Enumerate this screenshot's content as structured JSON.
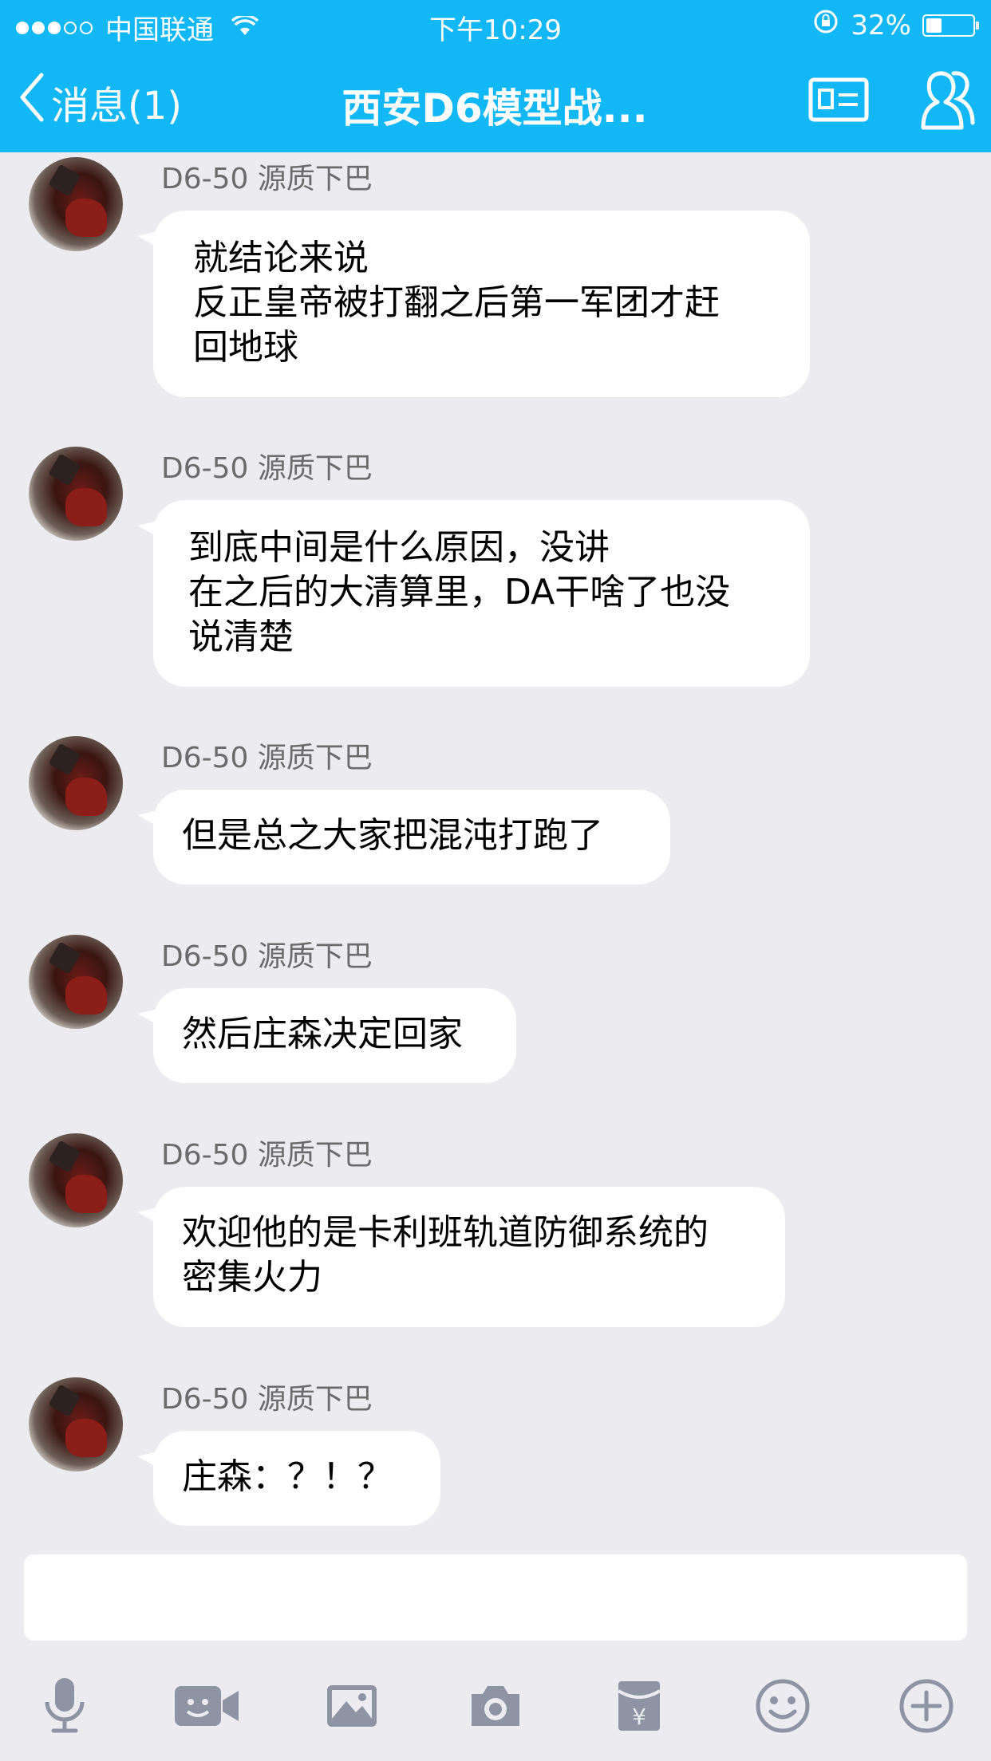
{
  "status_bar": {
    "carrier": "中国联通",
    "time": "下午10:29",
    "battery_percent": "32%",
    "battery_level": 0.32
  },
  "nav": {
    "back_label": "消息(1)",
    "title": "西安D6模型战..."
  },
  "messages": [
    {
      "sender": "D6-50 源质下巴",
      "lines": [
        "就结论来说",
        "反正皇帝被打翻之后第一军团才赶",
        "回地球"
      ]
    },
    {
      "sender": "D6-50 源质下巴",
      "lines": [
        "到底中间是什么原因，没讲",
        "在之后的大清算里，DA干啥了也没",
        "说清楚"
      ]
    },
    {
      "sender": "D6-50 源质下巴",
      "lines": [
        "但是总之大家把混沌打跑了"
      ]
    },
    {
      "sender": "D6-50 源质下巴",
      "lines": [
        "然后庄森决定回家"
      ]
    },
    {
      "sender": "D6-50 源质下巴",
      "lines": [
        "欢迎他的是卡利班轨道防御系统的",
        "密集火力"
      ]
    },
    {
      "sender": "D6-50 源质下巴",
      "lines": [
        "庄森：？！？"
      ]
    }
  ],
  "input": {
    "value": ""
  },
  "toolbar": {
    "icons": [
      "microphone-icon",
      "video-icon",
      "image-icon",
      "camera-icon",
      "red-envelope-icon",
      "emoji-icon",
      "plus-icon"
    ]
  },
  "colors": {
    "header": "#12b7f5",
    "background": "#ebebf0",
    "bubble": "#ffffff",
    "toolbar_icon": "#8e94a3"
  }
}
